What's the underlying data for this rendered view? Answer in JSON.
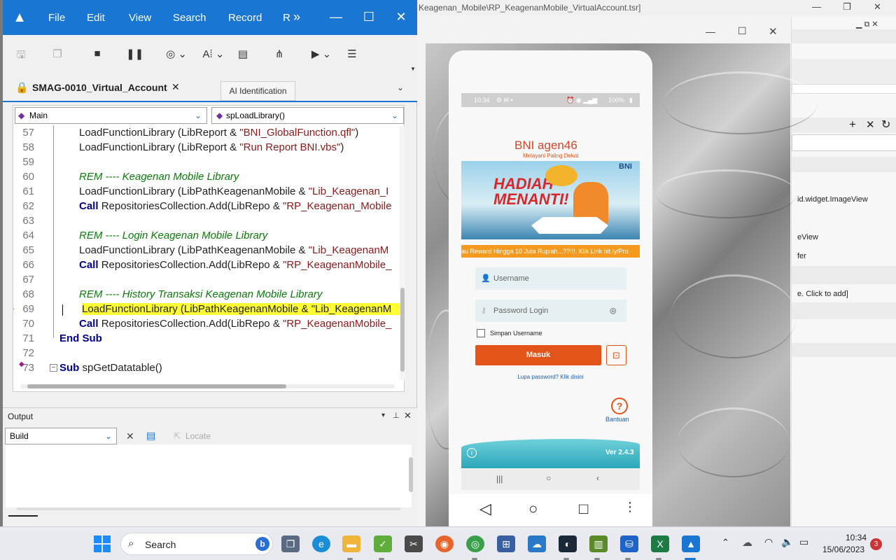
{
  "bg_window": {
    "title": "Keagenan_Mobile\\RP_KeagenanMobile_VirtualAccount.tsr]",
    "items": [
      "id.widget.ImageView",
      "eView",
      "fer",
      "e. Click to add]"
    ]
  },
  "qtp": {
    "menu": [
      "File",
      "Edit",
      "View",
      "Search",
      "Record",
      "R"
    ],
    "doc_tab": "SMAG-0010_Virtual_Account",
    "ai_tab": "AI Identification",
    "scope_dropdown": "Main",
    "proc_dropdown": "spLoadLibrary()",
    "code_lines": [
      {
        "n": "57",
        "parts": [
          {
            "t": "LoadFunctionLibrary (LibReport & ",
            "c": ""
          },
          {
            "t": "\"BNI_GlobalFunction.qfl\"",
            "c": "str"
          },
          {
            "t": ")",
            "c": ""
          }
        ]
      },
      {
        "n": "58",
        "parts": [
          {
            "t": "LoadFunctionLibrary (LibReport & ",
            "c": ""
          },
          {
            "t": "\"Run Report BNI.vbs\"",
            "c": "str"
          },
          {
            "t": ")",
            "c": ""
          }
        ]
      },
      {
        "n": "59",
        "parts": []
      },
      {
        "n": "60",
        "parts": [
          {
            "t": "REM ---- Keagenan Mobile Library",
            "c": "rem"
          }
        ]
      },
      {
        "n": "61",
        "parts": [
          {
            "t": "LoadFunctionLibrary (LibPathKeagenanMobile & ",
            "c": ""
          },
          {
            "t": "\"Lib_Keagenan_I",
            "c": "str"
          }
        ]
      },
      {
        "n": "62",
        "parts": [
          {
            "t": "Call ",
            "c": "kw"
          },
          {
            "t": "RepositoriesCollection.Add(LibRepo & ",
            "c": ""
          },
          {
            "t": "\"RP_Keagenan_Mobile",
            "c": "str"
          }
        ]
      },
      {
        "n": "63",
        "parts": []
      },
      {
        "n": "64",
        "parts": [
          {
            "t": "REM ---- Login Keagenan Mobile Library",
            "c": "rem"
          }
        ]
      },
      {
        "n": "65",
        "parts": [
          {
            "t": "LoadFunctionLibrary (LibPathKeagenanMobile & ",
            "c": ""
          },
          {
            "t": "\"Lib_KeagenanM",
            "c": "str"
          }
        ]
      },
      {
        "n": "66",
        "parts": [
          {
            "t": "Call ",
            "c": "kw"
          },
          {
            "t": "RepositoriesCollection.Add(LibRepo & ",
            "c": ""
          },
          {
            "t": "\"RP_KeagenanMobile_",
            "c": "str"
          }
        ]
      },
      {
        "n": "67",
        "parts": []
      },
      {
        "n": "68",
        "parts": [
          {
            "t": "REM ---- History Transaksi Keagenan Mobile Library",
            "c": "rem"
          }
        ]
      },
      {
        "n": "69",
        "parts": [
          {
            "t": "LoadFunctionLibrary (LibPathKeagenanMobile & \"Lib_KeagenanM",
            "c": ""
          }
        ],
        "highlight": true
      },
      {
        "n": "70",
        "parts": [
          {
            "t": "Call ",
            "c": "kw"
          },
          {
            "t": "RepositoriesCollection.Add(LibRepo & ",
            "c": ""
          },
          {
            "t": "\"RP_KeagenanMobile_",
            "c": "str"
          }
        ]
      },
      {
        "n": "71",
        "parts": [
          {
            "t": "End Sub",
            "c": "kw"
          }
        ]
      },
      {
        "n": "72",
        "parts": []
      },
      {
        "n": "73",
        "parts": [
          {
            "t": "Sub ",
            "c": "kw"
          },
          {
            "t": "spGetDatatable()",
            "c": ""
          }
        ]
      }
    ],
    "output_title": "Output",
    "output_dropdown": "Build",
    "locate_label": "Locate"
  },
  "phone": {
    "status_time": "10:34",
    "status_right": "100%",
    "brand": "BNI agen46",
    "tagline": "Melayani Paling Dekat",
    "banner_headline": "HADIAH MENANTI!",
    "banner_brand": "BNI",
    "marquee": "au Reward Hingga 10 Juta Rupiah...??!!!. Klik Link bit.ly/Pro",
    "username_placeholder": "Username",
    "password_placeholder": "Password Login",
    "remember_label": "Simpan Username",
    "login_button": "Masuk",
    "forgot_link": "Lupa password? Klik disini",
    "help_label": "Bantuan",
    "version": "Ver 2.4.3"
  },
  "taskbar": {
    "search_label": "Search",
    "time": "10:34",
    "date": "15/06/2023",
    "notif_count": "3"
  },
  "colors": {
    "accent": "#1976d2",
    "login_button": "#e2541a",
    "highlight": "#ffff33",
    "phone_footer": "#3bb3c3"
  }
}
